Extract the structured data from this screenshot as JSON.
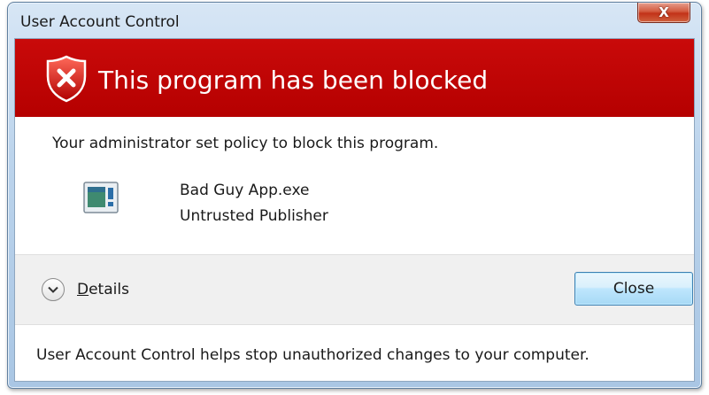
{
  "window": {
    "title": "User Account Control",
    "close_glyph": "X"
  },
  "banner": {
    "title": "This program has been blocked",
    "icon": "shield-error-icon",
    "color": "#b50000"
  },
  "message": "Your administrator set policy to block this program.",
  "program": {
    "icon": "application-icon",
    "name": "Bad Guy App.exe",
    "publisher": "Untrusted Publisher"
  },
  "actions": {
    "details_mnemonic": "D",
    "details_rest": "etails",
    "details_icon": "chevron-down-icon",
    "close_label": "Close"
  },
  "footer": "User Account Control helps stop unauthorized changes to your computer."
}
